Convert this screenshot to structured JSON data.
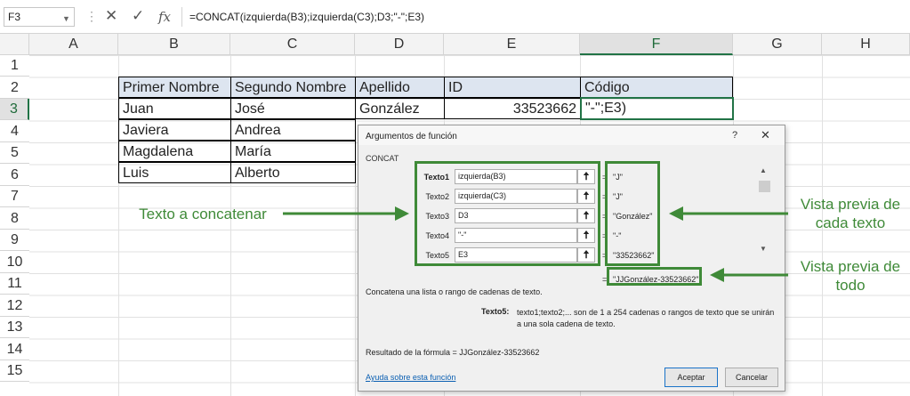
{
  "formula_bar": {
    "name_box": "F3",
    "formula": "=CONCAT(izquierda(B3);izquierda(C3);D3;\"-\";E3)",
    "cancel_icon": "✕",
    "enter_icon": "✓",
    "fx": "fx"
  },
  "columns": [
    "A",
    "B",
    "C",
    "D",
    "E",
    "F",
    "G",
    "H"
  ],
  "rows": [
    "1",
    "2",
    "3",
    "4",
    "5",
    "6",
    "7",
    "8",
    "9",
    "10",
    "11",
    "12",
    "13",
    "14",
    "15"
  ],
  "table": {
    "headers": [
      "Primer Nombre",
      "Segundo Nombre",
      "Apellido",
      "ID",
      "Código"
    ],
    "rows": [
      [
        "Juan",
        "José",
        "González",
        "33523662",
        "\"-\";E3)"
      ],
      [
        "Javiera",
        "Andrea",
        "",
        "",
        ""
      ],
      [
        "Magdalena",
        "María",
        "",
        "",
        ""
      ],
      [
        "Luis",
        "Alberto",
        "",
        "",
        ""
      ]
    ]
  },
  "dialog": {
    "title": "Argumentos de función",
    "help": "?",
    "close": "✕",
    "function_name": "CONCAT",
    "args": [
      {
        "label": "Texto1",
        "value": "izquierda(B3)",
        "preview": "\"J\""
      },
      {
        "label": "Texto2",
        "value": "izquierda(C3)",
        "preview": "\"J\""
      },
      {
        "label": "Texto3",
        "value": "D3",
        "preview": "\"González\""
      },
      {
        "label": "Texto4",
        "value": "\"-\"",
        "preview": "\"-\""
      },
      {
        "label": "Texto5",
        "value": "E3",
        "preview": "\"33523662\""
      }
    ],
    "arg_button": "🠅",
    "equals": "=",
    "result_preview": "\"JJGonzález-33523662\"",
    "description": "Concatena una lista o rango de cadenas de texto.",
    "arg_desc_label": "Texto5:",
    "arg_desc": "texto1;texto2;... son de 1 a 254 cadenas o rangos de texto que se unirán a una sola cadena de texto.",
    "formula_result": "Resultado de la fórmula =   JJGonzález-33523662",
    "help_link": "Ayuda sobre esta función",
    "ok": "Aceptar",
    "cancel": "Cancelar"
  },
  "annotations": {
    "left": "Texto a concatenar",
    "right_top": "Vista previa de cada texto",
    "right_bottom": "Vista previa de todo",
    "color": "#3f8a38"
  }
}
